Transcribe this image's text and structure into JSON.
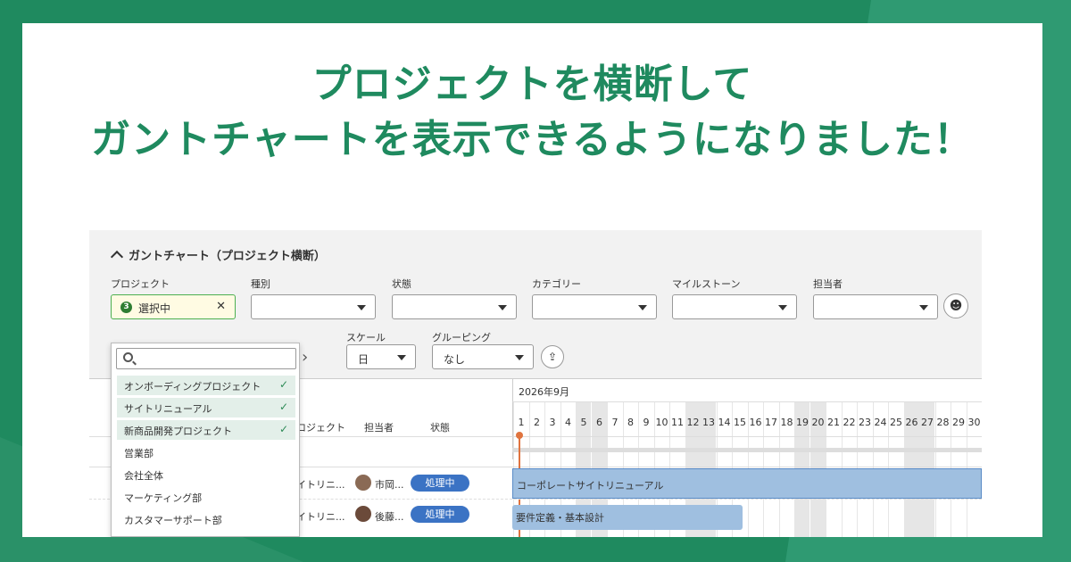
{
  "headline": {
    "line1": "プロジェクトを横断して",
    "line2": "ガントチャートを表示できるようになりました！"
  },
  "section": {
    "title": "ガントチャート（プロジェクト横断）"
  },
  "filters": {
    "project_label": "プロジェクト",
    "project_count": "3",
    "project_value": "選択中",
    "type_label": "種別",
    "status_label": "状態",
    "category_label": "カテゴリー",
    "milestone_label": "マイルストーン",
    "assignee_label": "担当者",
    "scale_label": "スケール",
    "scale_value": "日",
    "grouping_label": "グルーピング",
    "grouping_value": "なし"
  },
  "dropdown": {
    "search_placeholder": "",
    "options": [
      {
        "label": "オンボーディングプロジェクト",
        "selected": true
      },
      {
        "label": "サイトリニューアル",
        "selected": true
      },
      {
        "label": "新商品開発プロジェクト",
        "selected": true
      },
      {
        "label": "営業部",
        "selected": false
      },
      {
        "label": "会社全体",
        "selected": false
      },
      {
        "label": "マーケティング部",
        "selected": false
      },
      {
        "label": "カスタマーサポート部",
        "selected": false
      }
    ]
  },
  "gantt": {
    "month": "2026年9月",
    "columns": {
      "project": "ロジェクト",
      "assignee": "担当者",
      "status": "状態"
    },
    "days": [
      "1",
      "2",
      "3",
      "4",
      "5",
      "6",
      "7",
      "8",
      "9",
      "10",
      "11",
      "12",
      "13",
      "14",
      "15",
      "16",
      "17",
      "18",
      "19",
      "20",
      "21",
      "22",
      "23",
      "24",
      "25",
      "26",
      "27",
      "28",
      "29",
      "30"
    ],
    "weekend_days": [
      5,
      6,
      12,
      13,
      19,
      20,
      26,
      27
    ],
    "rows": [
      {
        "project": "イトリニ...",
        "assignee": "市岡...",
        "status": "処理中",
        "bar_label": "コーポレートサイトリニューアル"
      },
      {
        "project": "イトリニ...",
        "assignee": "後藤...",
        "status": "処理中",
        "bar_label": "要件定義・基本設計"
      }
    ]
  },
  "colors": {
    "brand": "#1f8a5f",
    "status": "#3b73c4",
    "bar": "#9fbfe0",
    "today": "#e0743f"
  }
}
